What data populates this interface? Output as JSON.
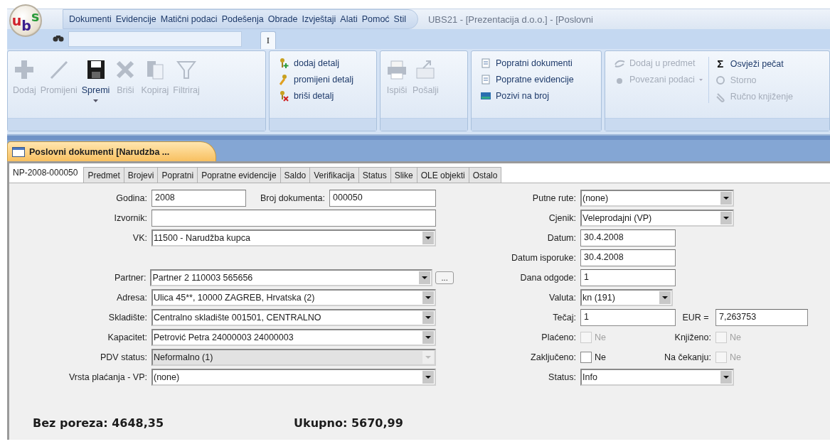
{
  "logo": {
    "letters": [
      {
        "text": "u",
        "color": "#d0202a"
      },
      {
        "text": "b",
        "color": "#3a1d8e"
      },
      {
        "text": "s",
        "color": "#2a9a3a"
      }
    ]
  },
  "menu": [
    "Dokumenti",
    "Evidencije",
    "Matični podaci",
    "Podešenja",
    "Obrade",
    "Izvještaji",
    "Alati",
    "Pomoć",
    "Stil"
  ],
  "window_title": "UBS21 - [Prezentacija d.o.o.] - [Poslovni",
  "quick_tab": "I",
  "ribbon": [
    {
      "kind": "large",
      "items": [
        {
          "label": "Dodaj",
          "disabled": true,
          "dropdown": false
        },
        {
          "label": "Promijeni",
          "disabled": true,
          "dropdown": false
        },
        {
          "label": "Spremi",
          "disabled": false,
          "dropdown": true
        },
        {
          "label": "Briši",
          "disabled": true,
          "dropdown": false
        },
        {
          "label": "Kopiraj",
          "disabled": true,
          "dropdown": false
        },
        {
          "label": "Filtriraj",
          "disabled": true,
          "dropdown": false
        }
      ]
    },
    {
      "kind": "list",
      "columns": [
        [
          {
            "label": "dodaj detalj",
            "disabled": false,
            "dropdown": false
          },
          {
            "label": "promijeni detalj",
            "disabled": false,
            "dropdown": false
          },
          {
            "label": "briši detalj",
            "disabled": false,
            "dropdown": false
          }
        ]
      ]
    },
    {
      "kind": "large",
      "items": [
        {
          "label": "Ispiši",
          "disabled": true,
          "dropdown": false
        },
        {
          "label": "Pošalji",
          "disabled": true,
          "dropdown": false
        }
      ]
    },
    {
      "kind": "list",
      "columns": [
        [
          {
            "label": "Popratni dokumenti",
            "disabled": false,
            "dropdown": false
          },
          {
            "label": "Popratne evidencije",
            "disabled": false,
            "dropdown": false
          },
          {
            "label": "Pozivi na broj",
            "disabled": false,
            "dropdown": false
          }
        ]
      ]
    },
    {
      "kind": "list",
      "columns": [
        [
          {
            "label": "Dodaj u predmet",
            "disabled": true,
            "dropdown": false
          },
          {
            "label": "Povezani podaci",
            "disabled": true,
            "dropdown": true
          }
        ],
        [
          {
            "label": "Osvježi pečat",
            "symbol": "Σ",
            "disabled": false,
            "dropdown": false
          },
          {
            "label": "Storno",
            "disabled": true,
            "dropdown": false
          },
          {
            "label": "Ručno knjiženje",
            "disabled": true,
            "dropdown": false
          }
        ]
      ]
    }
  ],
  "document_tab": "Poslovni dokumenti [Narudzba ...",
  "tabs": [
    {
      "label": "NP-2008-000050",
      "selected": true
    },
    {
      "label": "Predmet",
      "selected": false
    },
    {
      "label": "Brojevi",
      "selected": false
    },
    {
      "label": "Popratni",
      "selected": false
    },
    {
      "label": "Popratne evidencije",
      "selected": false
    },
    {
      "label": "Saldo",
      "selected": false
    },
    {
      "label": "Verifikacija",
      "selected": false
    },
    {
      "label": "Status",
      "selected": false
    },
    {
      "label": "Slike",
      "selected": false
    },
    {
      "label": "OLE objekti",
      "selected": false
    },
    {
      "label": "Ostalo",
      "selected": false
    }
  ],
  "left_fields": [
    [
      {
        "kind": "pair",
        "label": "Godina:",
        "value": "2008",
        "label2": "Broj dokumenta:",
        "value2": "000050"
      },
      {
        "kind": "text",
        "label": "Izvornik:"
      },
      {
        "kind": "combo",
        "label": "VK:",
        "value": "11500 - Narudžba kupca",
        "disabled": false
      }
    ],
    [
      {
        "kind": "combo",
        "label": "Partner:",
        "value": "Partner 2 110003 565656",
        "disabled": false,
        "browse": "..."
      },
      {
        "kind": "combo",
        "label": "Adresa:",
        "value": "Ulica 45**, 10000 ZAGREB, Hrvatska (2)",
        "disabled": false
      },
      {
        "kind": "combo",
        "label": "Skladište:",
        "value": "Centralno skladište 001501, CENTRALNO",
        "disabled": false
      },
      {
        "kind": "combo",
        "label": "Kapacitet:",
        "value": "Petrović Petra 24000003 24000003",
        "disabled": false
      },
      {
        "kind": "combo",
        "label": "PDV status:",
        "value": "Neformalno (1)",
        "disabled": true
      },
      {
        "kind": "combo",
        "label": "Vrsta plaćanja - VP:",
        "value": "(none)",
        "disabled": false
      }
    ]
  ],
  "right_fields": [
    {
      "kind": "combo",
      "label": "Putne rute:",
      "value": "(none)"
    },
    {
      "kind": "combo",
      "label": "Cjenik:",
      "value": "Veleprodajni (VP)"
    },
    {
      "kind": "text",
      "label": "Datum:",
      "value": "30.4.2008"
    },
    {
      "kind": "text",
      "label": "Datum isporuke:",
      "value": "30.4.2008"
    },
    {
      "kind": "text",
      "label": "Dana odgode:",
      "value": "1"
    },
    {
      "kind": "narrow-combo",
      "label": "Valuta:",
      "value": "kn (191)"
    },
    {
      "kind": "pair",
      "label": "Tečaj:",
      "value": "1",
      "label2": "EUR =",
      "value2": "7,263753"
    },
    {
      "kind": "checks",
      "items": [
        {
          "label": "Plaćeno:",
          "text": "Ne",
          "checked": false,
          "disabled": true
        },
        {
          "label": "Knjiženo:",
          "text": "Ne",
          "checked": false,
          "disabled": true
        }
      ]
    },
    {
      "kind": "checks",
      "items": [
        {
          "label": "Zaključeno:",
          "text": "Ne",
          "checked": false,
          "disabled": false
        },
        {
          "label": "Na čekanju:",
          "text": "Ne",
          "checked": false,
          "disabled": true
        }
      ]
    },
    {
      "kind": "combo",
      "label": "Status:",
      "value": "Info"
    }
  ],
  "totals": [
    {
      "text": "Bez poreza: 4648,35"
    },
    {
      "text": "Ukupno: 5670,99"
    }
  ]
}
